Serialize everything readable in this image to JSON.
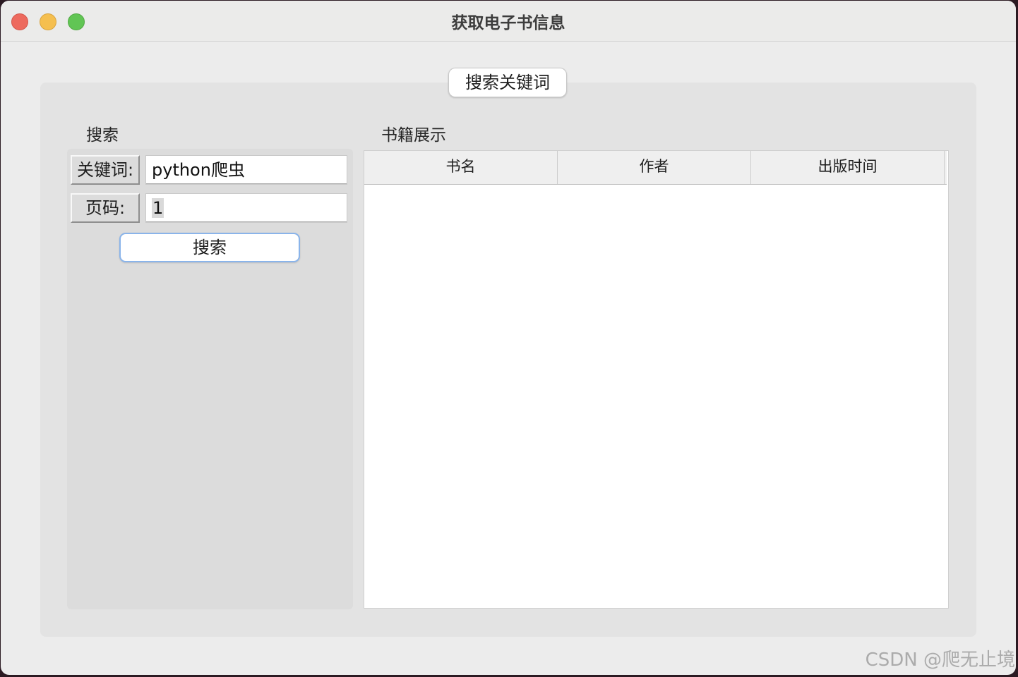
{
  "window": {
    "title": "获取电子书信息"
  },
  "top_button": {
    "label": "搜索关键词"
  },
  "search_panel": {
    "title": "搜索",
    "keyword_label": "关键词:",
    "keyword_value": "python爬虫",
    "page_label": "页码:",
    "page_value": "1",
    "search_button": "搜索"
  },
  "books_panel": {
    "title": "书籍展示",
    "columns": [
      "书名",
      "作者",
      "出版时间"
    ],
    "rows": []
  },
  "watermark": "CSDN @爬无止境",
  "colors": {
    "close": "#ed6a5e",
    "minimize": "#f5bf4f",
    "zoom": "#61c554",
    "focus_ring": "#8ab4ea"
  }
}
